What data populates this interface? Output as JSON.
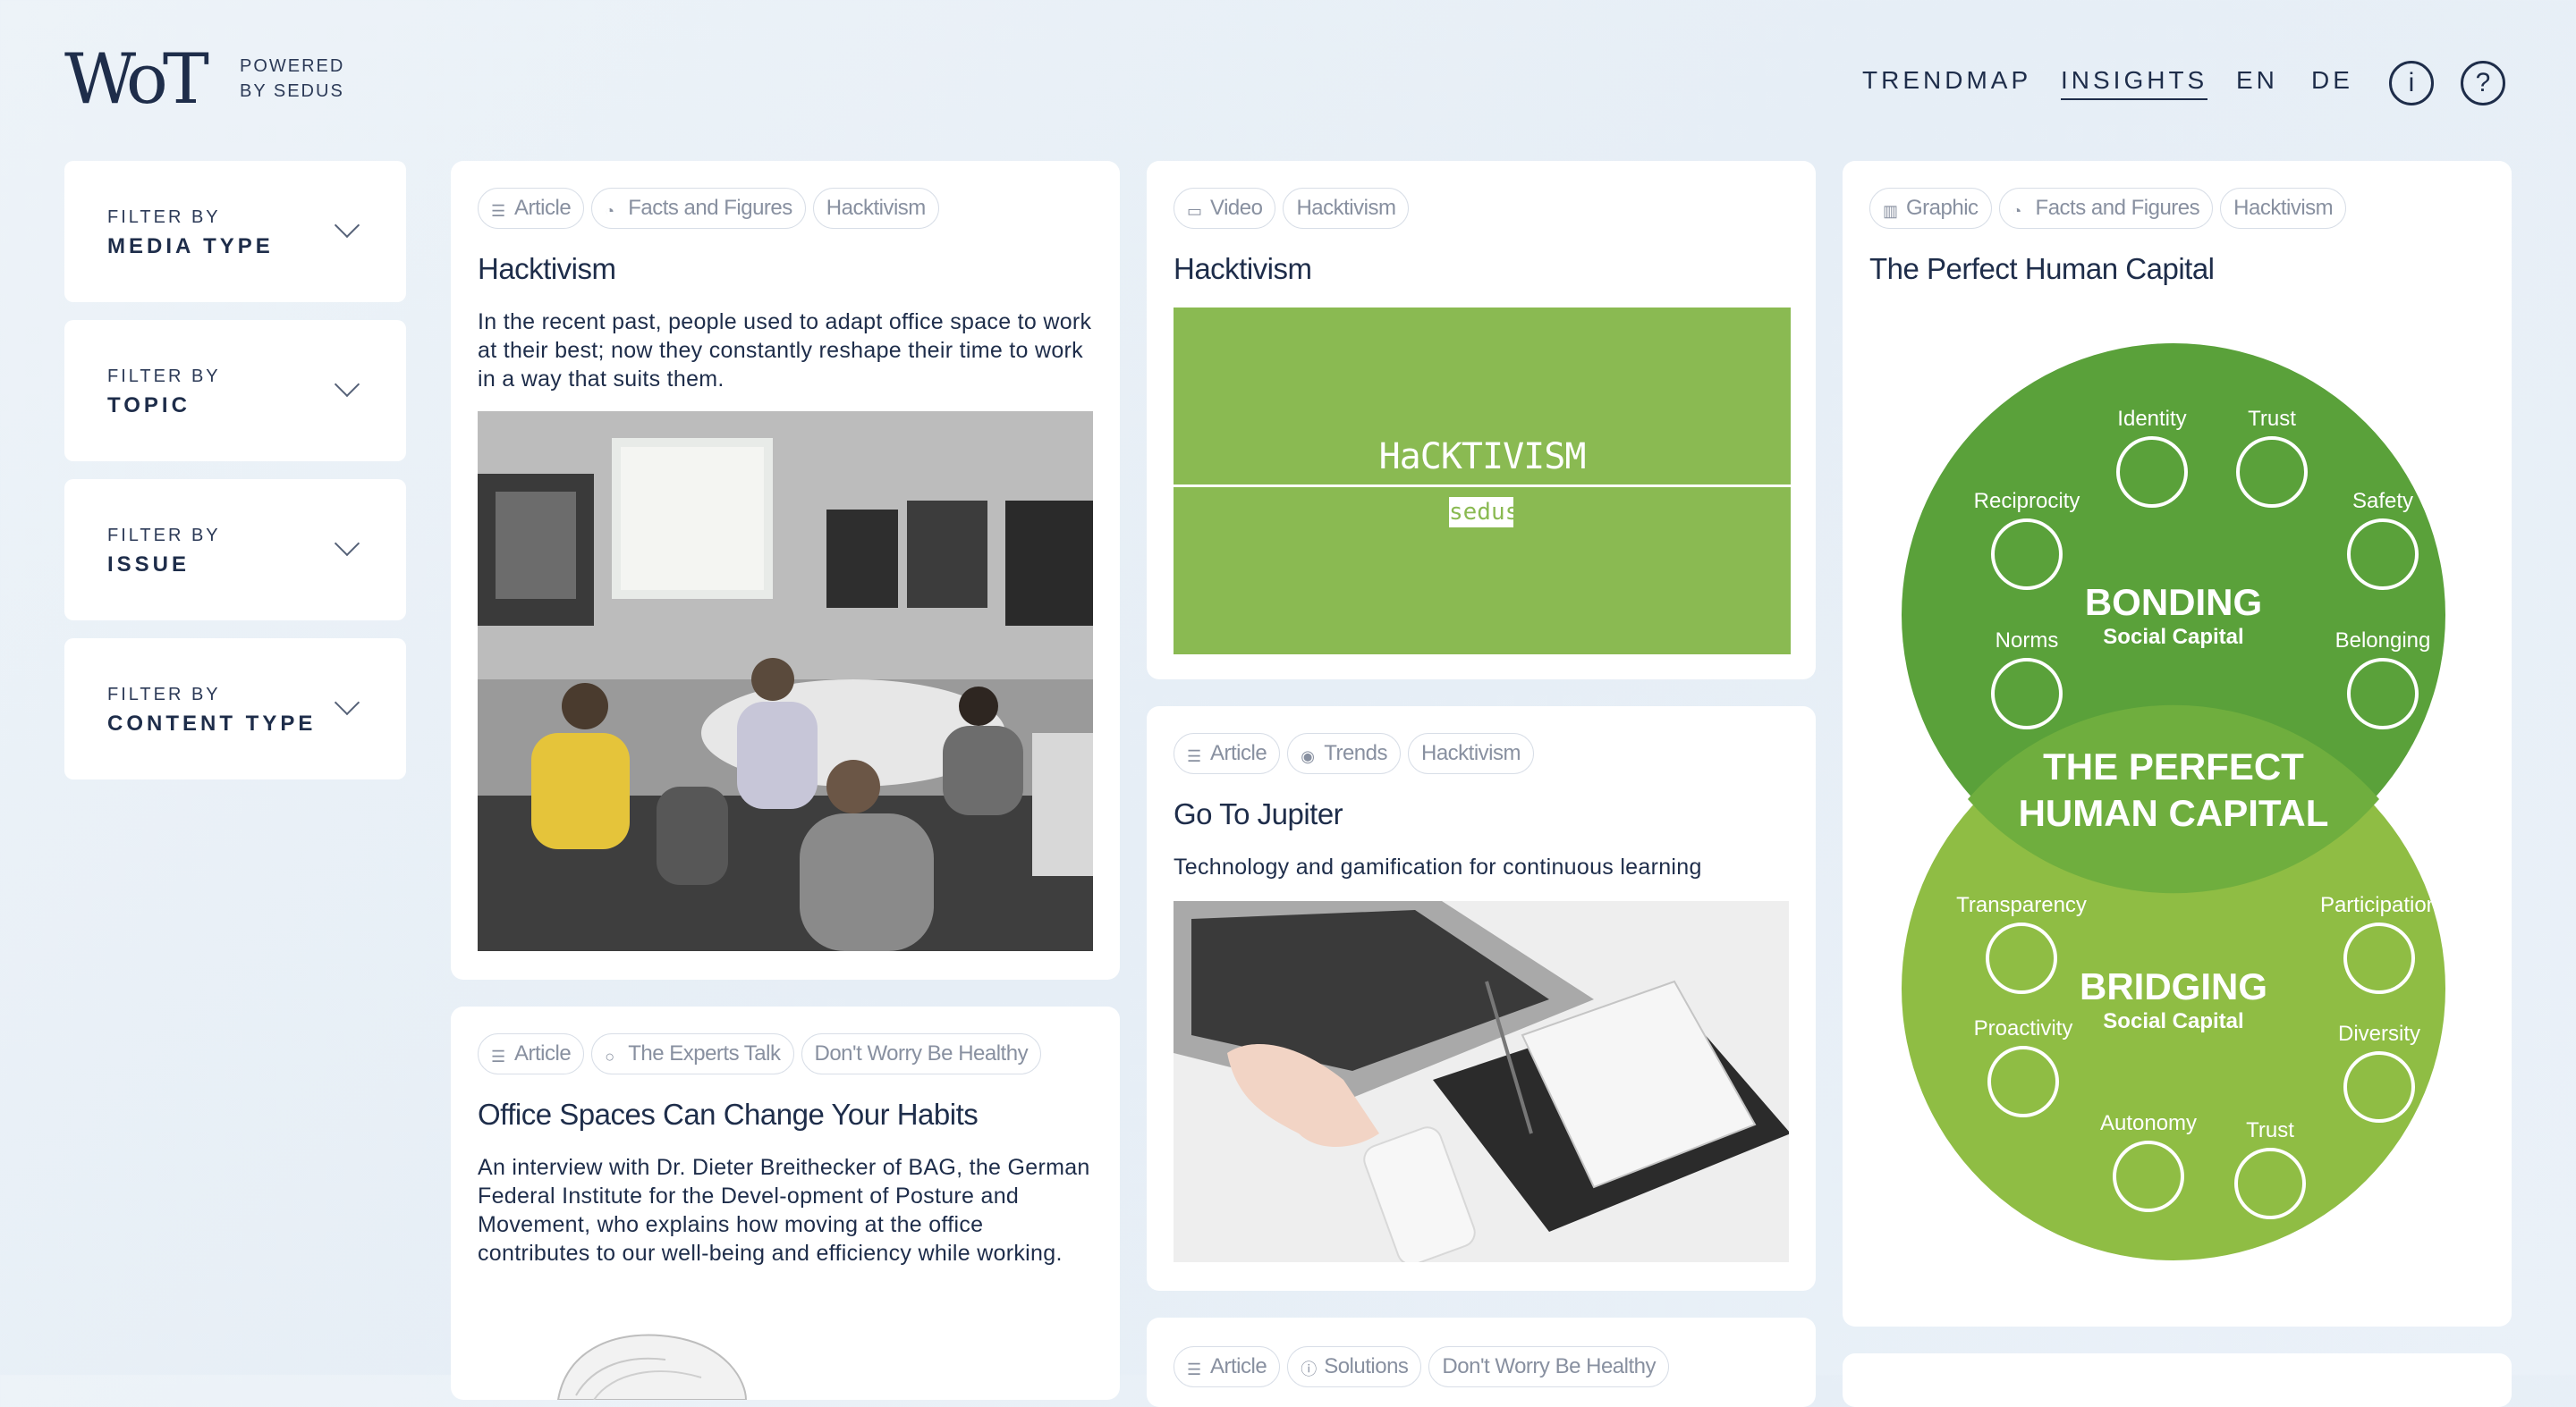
{
  "header": {
    "logo": "WoT",
    "powered_line1": "POWERED",
    "powered_line2": "BY SEDUS",
    "nav": {
      "trendmap": "TRENDMAP",
      "insights": "INSIGHTS",
      "en": "EN",
      "de": "DE"
    },
    "info_icon_label": "i",
    "help_icon_label": "?"
  },
  "filters": [
    {
      "prefix": "FILTER BY",
      "label": "MEDIA TYPE"
    },
    {
      "prefix": "FILTER BY",
      "label": "TOPIC"
    },
    {
      "prefix": "FILTER BY",
      "label": "ISSUE"
    },
    {
      "prefix": "FILTER BY",
      "label": "CONTENT TYPE"
    }
  ],
  "cards": {
    "c1": {
      "tags": [
        {
          "icon": "article-icon",
          "label": "Article"
        },
        {
          "icon": "chart-icon",
          "label": "Facts and Figures"
        },
        {
          "icon": "",
          "label": "Hacktivism"
        }
      ],
      "title": "Hacktivism",
      "desc": "In the recent past, people used to adapt office space to work at their best; now they constantly reshape their time to work in a way that suits them."
    },
    "c2": {
      "tags": [
        {
          "icon": "article-icon",
          "label": "Article"
        },
        {
          "icon": "speech-bubble-icon",
          "label": "The Experts Talk"
        },
        {
          "icon": "",
          "label": "Don't Worry Be Healthy"
        }
      ],
      "title": "Office Spaces Can Change Your Habits",
      "desc": "An interview with Dr. Dieter Breithecker of BAG, the German Federal Institute for the Devel-opment of Posture and Movement, who explains how moving at the office contributes to our well-being and efficiency while working."
    },
    "c3": {
      "tags": [
        {
          "icon": "video-icon",
          "label": "Video"
        },
        {
          "icon": "",
          "label": "Hacktivism"
        }
      ],
      "title": "Hacktivism",
      "video_title": "HaCKTIVISM",
      "video_brand": "sedus"
    },
    "c4": {
      "tags": [
        {
          "icon": "article-icon",
          "label": "Article"
        },
        {
          "icon": "target-icon",
          "label": "Trends"
        },
        {
          "icon": "",
          "label": "Hacktivism"
        }
      ],
      "title": "Go To Jupiter",
      "desc": "Technology and gamification for continuous learning"
    },
    "c5": {
      "tags": [
        {
          "icon": "article-icon",
          "label": "Article"
        },
        {
          "icon": "info-circle-icon",
          "label": "Solutions"
        },
        {
          "icon": "",
          "label": "Don't Worry Be Healthy"
        }
      ]
    },
    "c6": {
      "tags": [
        {
          "icon": "bar-chart-icon",
          "label": "Graphic"
        },
        {
          "icon": "chart-icon",
          "label": "Facts and Figures"
        },
        {
          "icon": "",
          "label": "Hacktivism"
        }
      ],
      "title": "The Perfect Human Capital",
      "graphic": {
        "bonding": "BONDING",
        "bonding_sub": "Social Capital",
        "center_1": "THE PERFECT",
        "center_2": "HUMAN CAPITAL",
        "bridging": "BRIDGING",
        "bridging_sub": "Social Capital",
        "identity": "Identity",
        "trust_top": "Trust",
        "reciprocity": "Reciprocity",
        "safety": "Safety",
        "norms": "Norms",
        "belonging": "Belonging",
        "transparency": "Transparency",
        "participation": "Participation",
        "proactivity": "Proactivity",
        "diversity": "Diversity",
        "autonomy": "Autonomy",
        "trust_bottom": "Trust",
        "colors": {
          "bonding": "#5aa13a",
          "bridging": "#8fbd44"
        }
      }
    }
  }
}
